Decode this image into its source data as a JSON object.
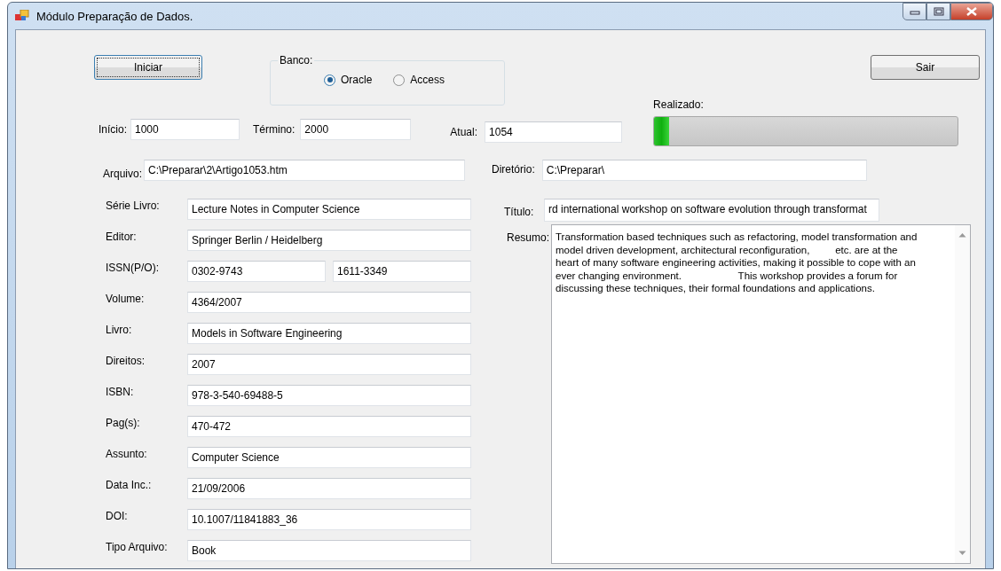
{
  "window": {
    "title": "Módulo Preparação de Dados."
  },
  "start_button": "Iniciar",
  "database": {
    "label": "Banco:",
    "options": [
      {
        "label": "Oracle",
        "selected": true
      },
      {
        "label": "Access",
        "selected": false
      }
    ]
  },
  "exit_button": "Sair",
  "range": [
    {
      "label": "Início:",
      "value": "1000"
    },
    {
      "label": "Término:",
      "value": "2000"
    },
    {
      "label": "Atual:",
      "value": "1054"
    }
  ],
  "progress": {
    "label": "Realizado:",
    "level": 0.05
  },
  "file": {
    "label": "Arquivo:",
    "value": "C:\\Preparar\\2\\Artigo1053.htm"
  },
  "directory": {
    "label": "Diretório:",
    "value": "C:\\Preparar\\"
  },
  "fields": [
    {
      "label": "Série Livro:",
      "values": [
        "Lecture Notes in Computer Science"
      ]
    },
    {
      "label": "Editor:",
      "values": [
        "Springer Berlin / Heidelberg"
      ]
    },
    {
      "label": "ISSN(P/O):",
      "values": [
        "0302-9743",
        "1611-3349"
      ]
    },
    {
      "label": "Volume:",
      "values": [
        "4364/2007"
      ]
    },
    {
      "label": "Livro:",
      "values": [
        "Models in Software Engineering"
      ]
    },
    {
      "label": "Direitos:",
      "values": [
        "2007"
      ]
    },
    {
      "label": "ISBN:",
      "values": [
        "978-3-540-69488-5"
      ]
    },
    {
      "label": "Pag(s):",
      "values": [
        "470-472"
      ]
    },
    {
      "label": "Assunto:",
      "values": [
        "Computer Science"
      ]
    },
    {
      "label": "Data Inc.:",
      "values": [
        "21/09/2006"
      ]
    },
    {
      "label": "DOI:",
      "values": [
        "10.1007/11841883_36"
      ]
    },
    {
      "label": "Tipo Arquivo:",
      "values": [
        "Book"
      ]
    }
  ],
  "title_field": {
    "label": "Título:",
    "value": "rd international workshop on software evolution through transformat"
  },
  "summary": {
    "label": "Resumo:",
    "value": "Transformation based techniques such as refactoring, model transformation and\nmodel driven development, architectural reconfiguration,         etc. are at the\nheart of many software engineering activities, making it possible to cope with an\never changing environment.                    This workshop provides a forum for\ndiscussing these techniques, their formal foundations and applications."
  }
}
